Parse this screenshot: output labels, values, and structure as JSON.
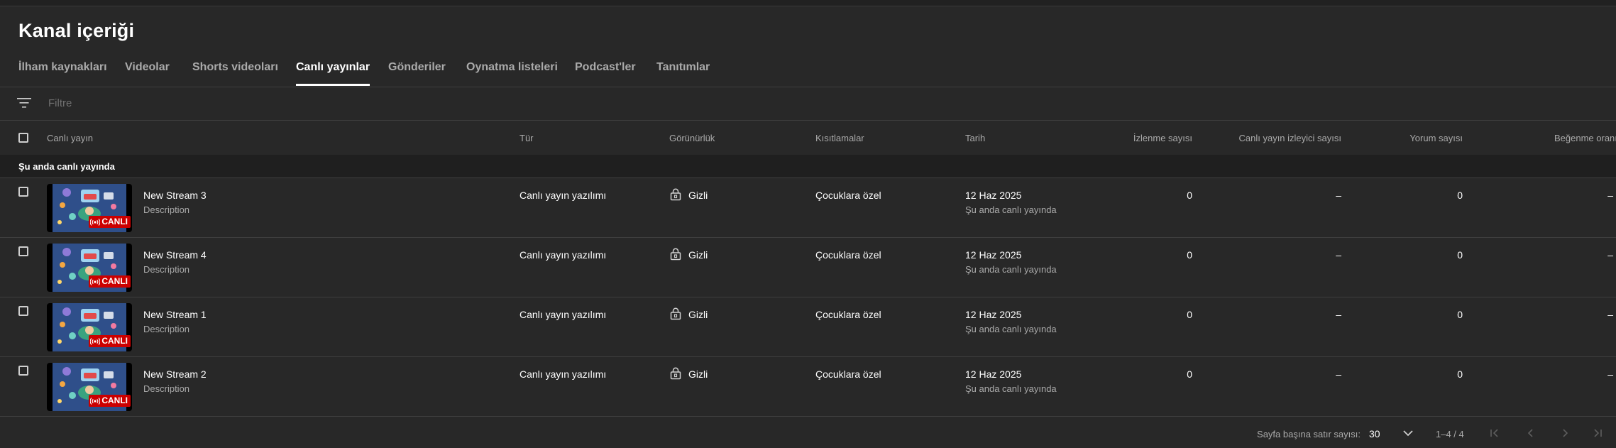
{
  "page": {
    "title": "Kanal içeriği"
  },
  "tabs": [
    {
      "label": "İlham kaynakları"
    },
    {
      "label": "Videolar"
    },
    {
      "label": "Shorts videoları"
    },
    {
      "label": "Canlı yayınlar"
    },
    {
      "label": "Gönderiler"
    },
    {
      "label": "Oynatma listeleri"
    },
    {
      "label": "Podcast'ler"
    },
    {
      "label": "Tanıtımlar"
    }
  ],
  "active_tab": "Canlı yayınlar",
  "filter": {
    "placeholder": "Filtre",
    "icon": "filter-icon"
  },
  "columns": {
    "live": "Canlı yayın",
    "type": "Tür",
    "visibility": "Görünürlük",
    "restrictions": "Kısıtlamalar",
    "date": "Tarih",
    "views": "İzlenme sayısı",
    "live_viewers": "Canlı yayın izleyici sayısı",
    "comments": "Yorum sayısı",
    "like_ratio": "Beğenme oranı"
  },
  "section": {
    "label": "Şu anda canlı yayında"
  },
  "live_badge": "CANLI",
  "rows": [
    {
      "title": "New Stream 3",
      "description": "Description",
      "type": "Canlı yayın yazılımı",
      "visibility": "Gizli",
      "restrictions": "Çocuklara özel",
      "date": "12 Haz 2025",
      "date_status": "Şu anda canlı yayında",
      "views": "0",
      "live_viewers": "–",
      "comments": "0",
      "like_ratio": "–"
    },
    {
      "title": "New Stream 4",
      "description": "Description",
      "type": "Canlı yayın yazılımı",
      "visibility": "Gizli",
      "restrictions": "Çocuklara özel",
      "date": "12 Haz 2025",
      "date_status": "Şu anda canlı yayında",
      "views": "0",
      "live_viewers": "–",
      "comments": "0",
      "like_ratio": "–"
    },
    {
      "title": "New Stream 1",
      "description": "Description",
      "type": "Canlı yayın yazılımı",
      "visibility": "Gizli",
      "restrictions": "Çocuklara özel",
      "date": "12 Haz 2025",
      "date_status": "Şu anda canlı yayında",
      "views": "0",
      "live_viewers": "–",
      "comments": "0",
      "like_ratio": "–"
    },
    {
      "title": "New Stream 2",
      "description": "Description",
      "type": "Canlı yayın yazılımı",
      "visibility": "Gizli",
      "restrictions": "Çocuklara özel",
      "date": "12 Haz 2025",
      "date_status": "Şu anda canlı yayında",
      "views": "0",
      "live_viewers": "–",
      "comments": "0",
      "like_ratio": "–"
    }
  ],
  "footer": {
    "rows_per_page_label": "Sayfa başına satır sayısı:",
    "rows_per_page_value": "30",
    "range": "1–4 / 4"
  },
  "colors": {
    "background": "#282828",
    "live_red": "#cc0000",
    "text_secondary": "#aaaaaa"
  }
}
